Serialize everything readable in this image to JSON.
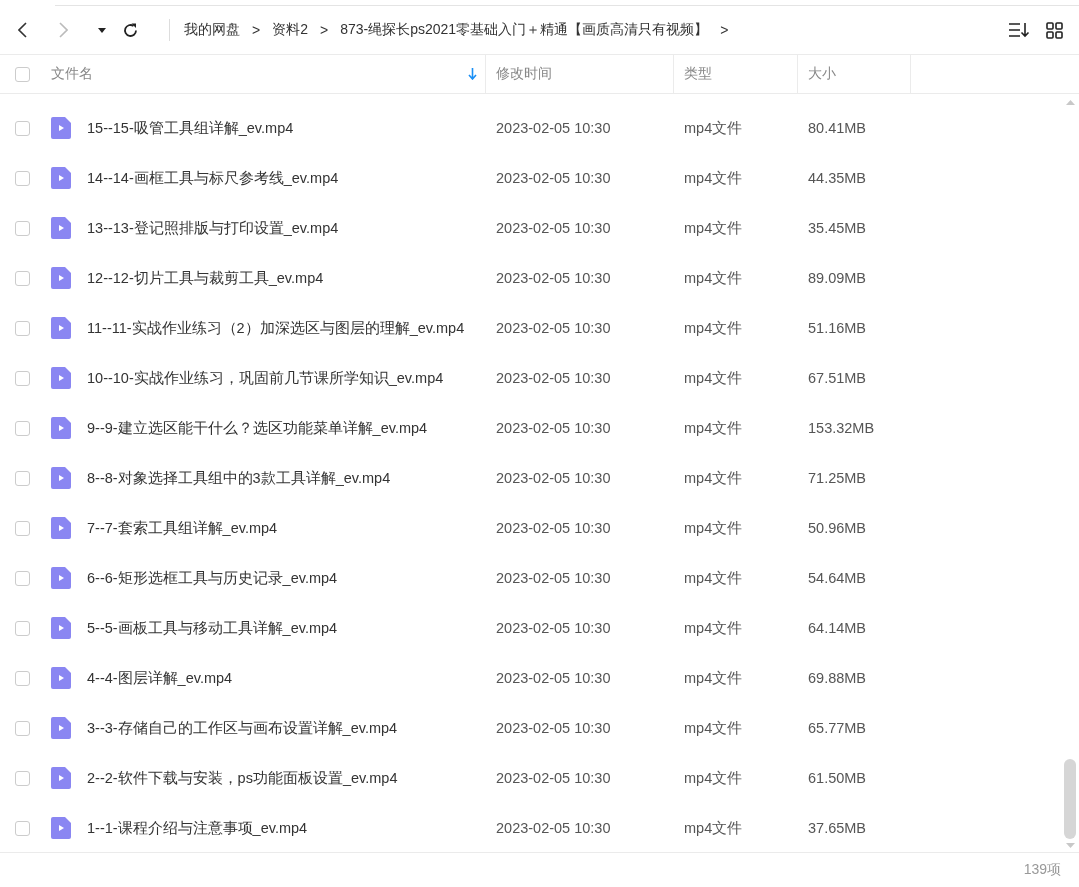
{
  "toolbar": {
    "breadcrumb": [
      "我的网盘",
      "资料2",
      "873-绳探长ps2021零基础入门＋精通【画质高清只有视频】"
    ],
    "separator": ">"
  },
  "table": {
    "columns": [
      {
        "label": "文件名",
        "sorted": true
      },
      {
        "label": "修改时间",
        "sorted": false
      },
      {
        "label": "类型",
        "sorted": false
      },
      {
        "label": "大小",
        "sorted": false
      }
    ],
    "select_all": {
      "checked": false
    },
    "rows": [
      {
        "name": "15--15-吸管工具组详解_ev.mp4",
        "modified": "2023-02-05 10:30",
        "type": "mp4文件",
        "size": "80.41MB",
        "checked": false
      },
      {
        "name": "14--14-画框工具与标尺参考线_ev.mp4",
        "modified": "2023-02-05 10:30",
        "type": "mp4文件",
        "size": "44.35MB",
        "checked": false
      },
      {
        "name": "13--13-登记照排版与打印设置_ev.mp4",
        "modified": "2023-02-05 10:30",
        "type": "mp4文件",
        "size": "35.45MB",
        "checked": false
      },
      {
        "name": "12--12-切片工具与裁剪工具_ev.mp4",
        "modified": "2023-02-05 10:30",
        "type": "mp4文件",
        "size": "89.09MB",
        "checked": false
      },
      {
        "name": "11--11-实战作业练习（2）加深选区与图层的理解_ev.mp4",
        "modified": "2023-02-05 10:30",
        "type": "mp4文件",
        "size": "51.16MB",
        "checked": false
      },
      {
        "name": "10--10-实战作业练习，巩固前几节课所学知识_ev.mp4",
        "modified": "2023-02-05 10:30",
        "type": "mp4文件",
        "size": "67.51MB",
        "checked": false
      },
      {
        "name": "9--9-建立选区能干什么？选区功能菜单详解_ev.mp4",
        "modified": "2023-02-05 10:30",
        "type": "mp4文件",
        "size": "153.32MB",
        "checked": false
      },
      {
        "name": "8--8-对象选择工具组中的3款工具详解_ev.mp4",
        "modified": "2023-02-05 10:30",
        "type": "mp4文件",
        "size": "71.25MB",
        "checked": false
      },
      {
        "name": "7--7-套索工具组详解_ev.mp4",
        "modified": "2023-02-05 10:30",
        "type": "mp4文件",
        "size": "50.96MB",
        "checked": false
      },
      {
        "name": "6--6-矩形选框工具与历史记录_ev.mp4",
        "modified": "2023-02-05 10:30",
        "type": "mp4文件",
        "size": "54.64MB",
        "checked": false
      },
      {
        "name": "5--5-画板工具与移动工具详解_ev.mp4",
        "modified": "2023-02-05 10:30",
        "type": "mp4文件",
        "size": "64.14MB",
        "checked": false
      },
      {
        "name": "4--4-图层详解_ev.mp4",
        "modified": "2023-02-05 10:30",
        "type": "mp4文件",
        "size": "69.88MB",
        "checked": false
      },
      {
        "name": "3--3-存储自己的工作区与画布设置详解_ev.mp4",
        "modified": "2023-02-05 10:30",
        "type": "mp4文件",
        "size": "65.77MB",
        "checked": false
      },
      {
        "name": "2--2-软件下载与安装，ps功能面板设置_ev.mp4",
        "modified": "2023-02-05 10:30",
        "type": "mp4文件",
        "size": "61.50MB",
        "checked": false
      },
      {
        "name": "1--1-课程介绍与注意事项_ev.mp4",
        "modified": "2023-02-05 10:30",
        "type": "mp4文件",
        "size": "37.65MB",
        "checked": false
      }
    ]
  },
  "status_bar": {
    "count": "139项"
  }
}
